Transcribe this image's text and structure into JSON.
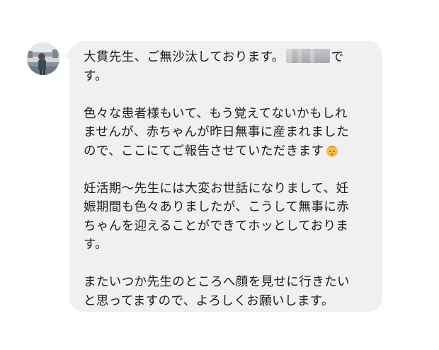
{
  "message": {
    "avatar_icon": "user-photo-avatar-icon",
    "bubble_color": "#f0f0f2",
    "text_color": "#1c1c1e",
    "redacted_name": "",
    "emoji_icon": "baby-emoji-icon",
    "lines": {
      "p1_l1_a": "大貫先生、ご無沙汰しております。",
      "p1_l1_b": "で",
      "p1_l2": "す。",
      "p2_l1": "色々な患者様もいて、もう覚えてないかもしれ",
      "p2_l2": "ませんが、赤ちゃんが昨日無事に産まれました",
      "p2_l3": "ので、ここにてご報告させていただきます",
      "p3_l1": "妊活期〜先生には大変お世話になりまして、妊",
      "p3_l2": "娠期間も色々ありましたが、こうして無事に赤",
      "p3_l3": "ちゃんを迎えることができてホッとしておりま",
      "p3_l4": "す。",
      "p4_l1": "またいつか先生のところへ顔を見せに行きたい",
      "p4_l2": "と思ってますので、よろしくお願いします。"
    }
  }
}
